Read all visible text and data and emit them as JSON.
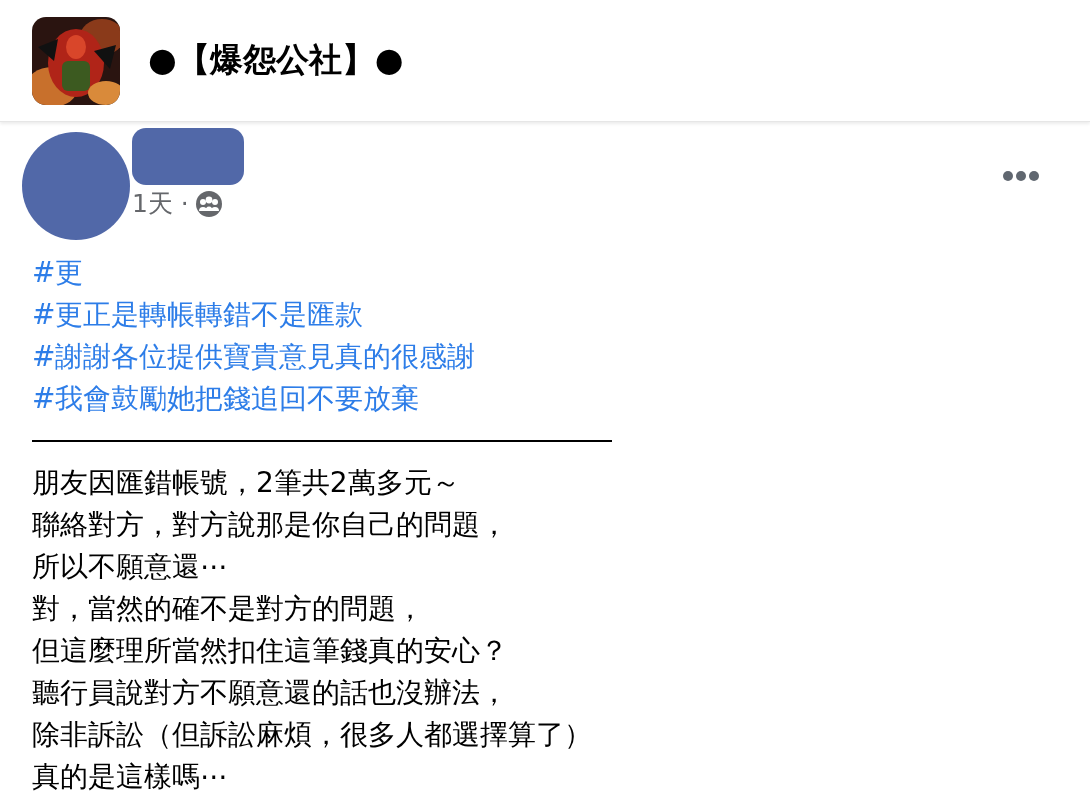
{
  "header": {
    "title": "●【爆怨公社】●"
  },
  "post": {
    "time": "1天 ·",
    "hashtags": [
      "#更",
      "#更正是轉帳轉錯不是匯款",
      "#謝謝各位提供寶貴意見真的很感謝",
      "#我會鼓勵她把錢追回不要放棄"
    ],
    "lines": [
      "朋友因匯錯帳號，2筆共2萬多元～",
      "聯絡對方，對方說那是你自己的問題，",
      "所以不願意還⋯",
      "對，當然的確不是對方的問題，",
      "但這麼理所當然扣住這筆錢真的安心？",
      "聽行員說對方不願意還的話也沒辦法，",
      "除非訴訟（但訴訟麻煩，很多人都選擇算了）",
      "真的是這樣嗎⋯"
    ]
  }
}
